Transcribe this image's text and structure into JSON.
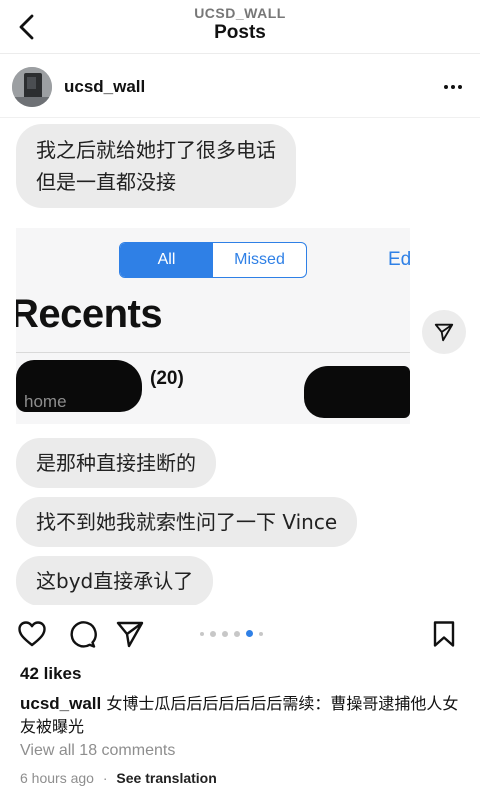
{
  "header": {
    "subtitle": "UCSD_WALL",
    "title": "Posts",
    "back_icon": "chevron-left-icon"
  },
  "post": {
    "username": "ucsd_wall",
    "more_icon": "more-horizontal-icon"
  },
  "media": {
    "bubbles": [
      {
        "line1": "我之后就给她打了很多电话",
        "line2": "但是一直都没接"
      },
      {
        "text": "是那种直接挂断的"
      },
      {
        "text": "找不到她我就索性问了一下 Vince"
      },
      {
        "text": "这byd直接承认了"
      }
    ],
    "phone_screenshot": {
      "tab_all": "All",
      "tab_missed": "Missed",
      "edit": "Ed",
      "heading": "Recents",
      "count": "(20)",
      "label": "home"
    },
    "carousel": {
      "total": 6,
      "active_index": 4
    },
    "accent": "#2f80e6"
  },
  "actions": {
    "like_icon": "heart-icon",
    "comment_icon": "comment-icon",
    "share_icon": "paper-plane-icon",
    "save_icon": "bookmark-icon"
  },
  "likes": "42 likes",
  "caption": {
    "username": "ucsd_wall",
    "text": "女博士瓜后后后后后后后需续：曹操哥逮捕他人女友被曝光"
  },
  "view_comments": "View all 18 comments",
  "timestamp": "6 hours ago",
  "separator": "·",
  "see_translation": "See translation"
}
